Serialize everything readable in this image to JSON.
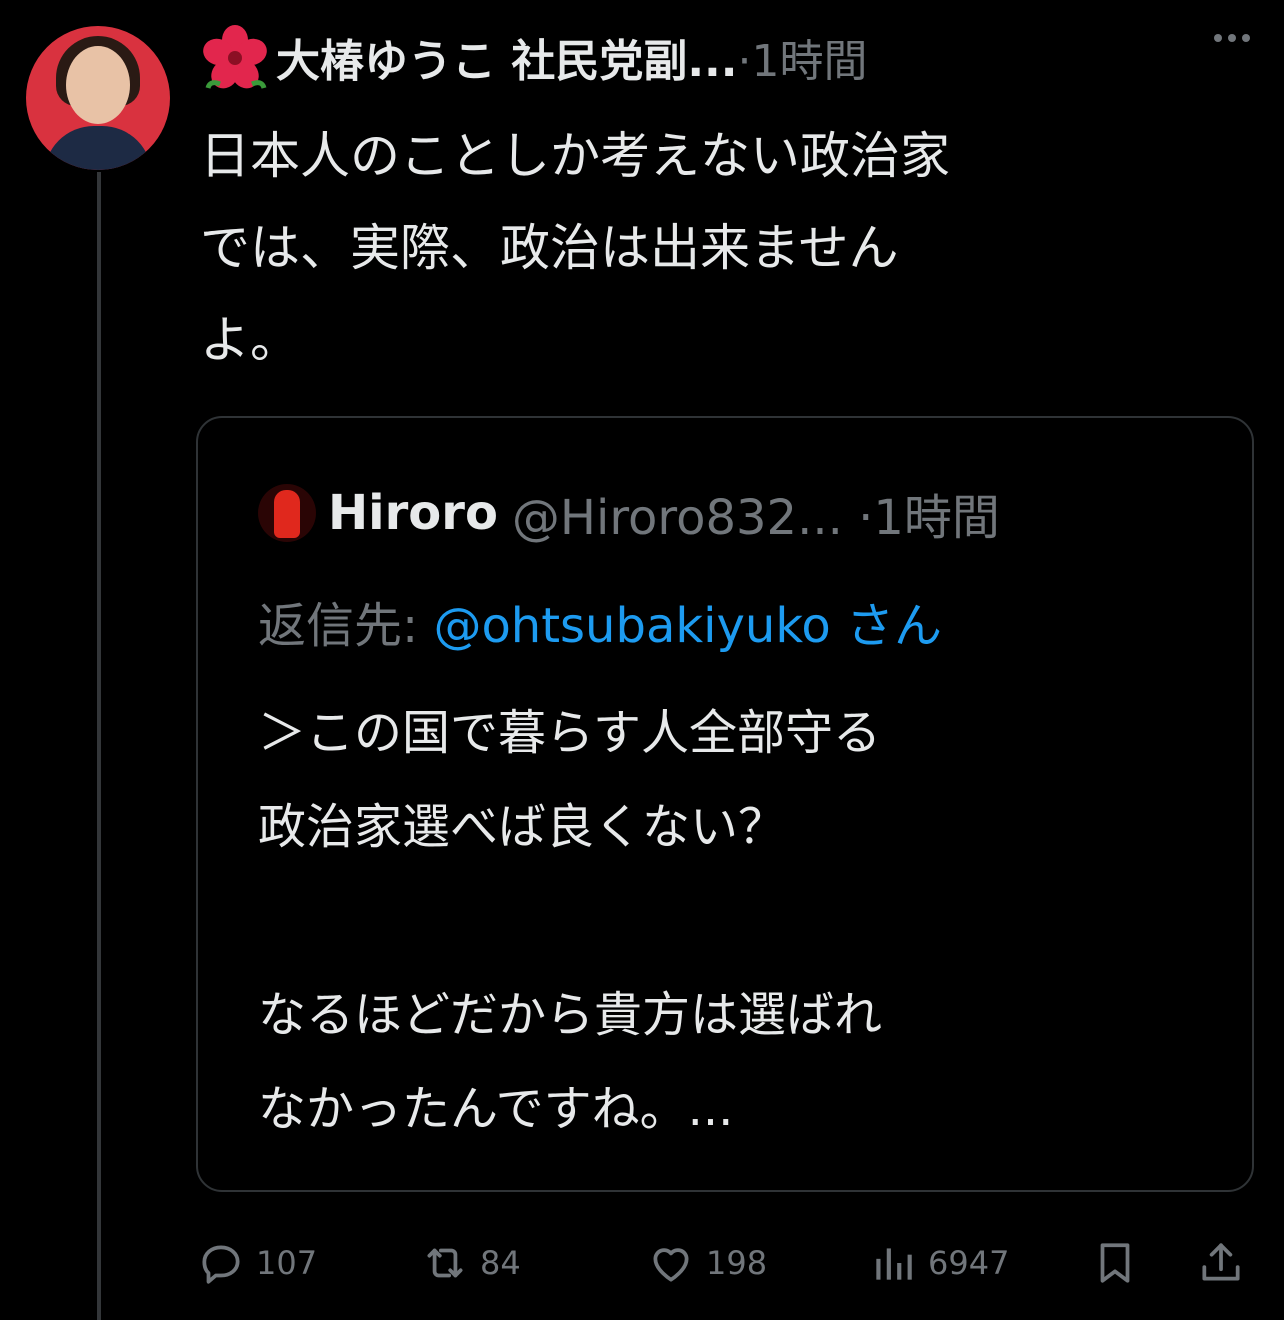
{
  "tweet": {
    "author_name": "大椿ゆうこ 社民党副...",
    "time": "·1時間",
    "text": "日本人のことしか考えない政治家\nでは、実際、政治は出来ません\nよ。"
  },
  "quote": {
    "author_name": "Hiroro",
    "handle_time": "@Hiroro832... ·1時間",
    "reply_prefix": "返信先: ",
    "reply_mention": "@ohtsubakiyuko",
    "reply_suffix": " さん",
    "text": "＞この国で暮らす人全部守る\n政治家選べば良くない？\n\nなるほどだから貴方は選ばれ\nなかったんですね。..."
  },
  "actions": {
    "replies": "107",
    "retweets": "84",
    "likes": "198",
    "views": "6947"
  },
  "icons": {
    "more": "more-dots-icon",
    "reply": "reply-bubble-icon",
    "retweet": "retweet-icon",
    "like": "heart-icon",
    "views": "views-chart-icon",
    "bookmark": "bookmark-icon",
    "share": "share-icon"
  }
}
